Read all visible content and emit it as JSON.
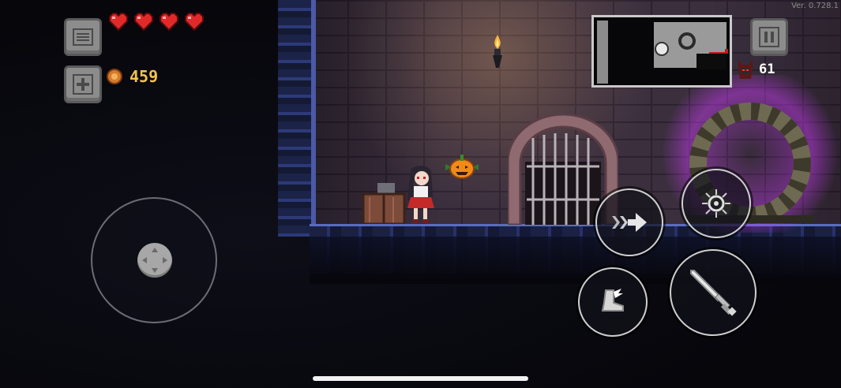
{
  "hud": {
    "version": "Ver. 0.728.1",
    "coins": "459",
    "enemy_count": "61",
    "hearts": 4
  },
  "colors": {
    "heart": "#e02a2a",
    "coin_text": "#f3c24f",
    "portal_glow": "#d23cff",
    "floor_edge": "#5a6cc2"
  },
  "icons": {
    "menu": "hamburger-icon",
    "add": "plus-icon",
    "pause": "pause-icon",
    "dash": "arrow-dash-icon",
    "skill": "spiky-orb-icon",
    "jump": "winged-boot-icon",
    "attack": "sword-icon"
  }
}
